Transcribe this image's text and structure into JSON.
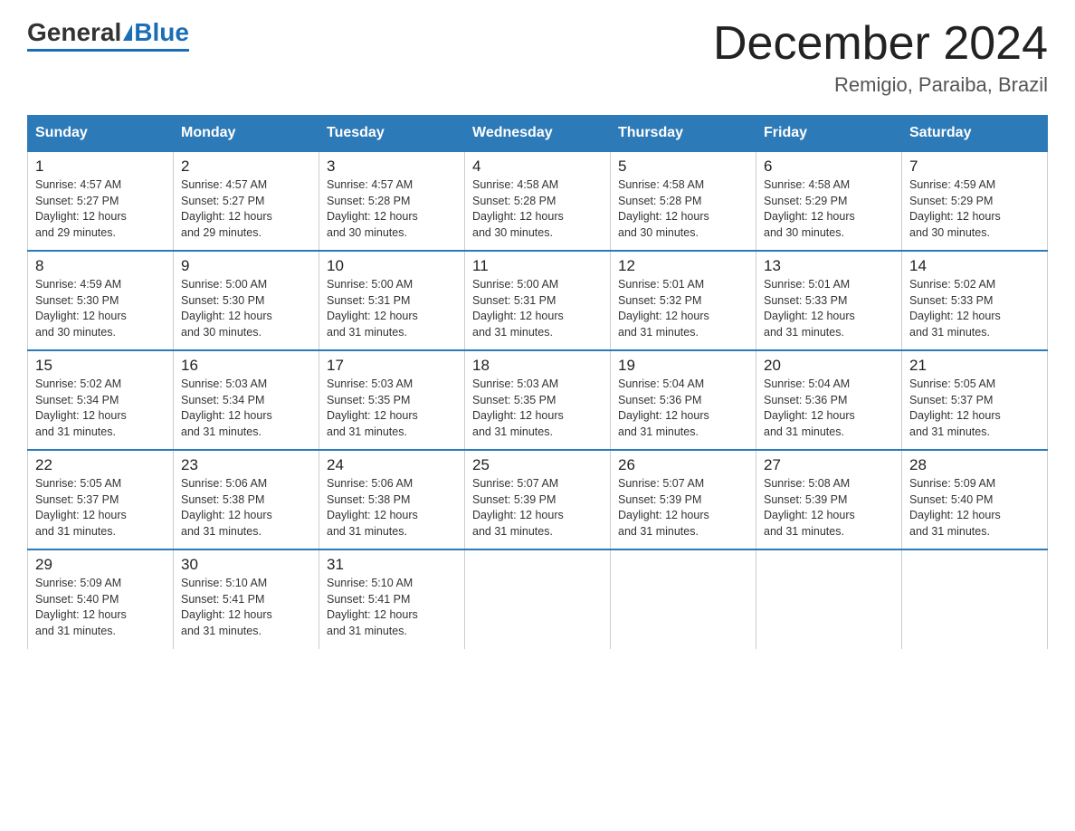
{
  "logo": {
    "general": "General",
    "blue": "Blue"
  },
  "title": "December 2024",
  "subtitle": "Remigio, Paraiba, Brazil",
  "headers": [
    "Sunday",
    "Monday",
    "Tuesday",
    "Wednesday",
    "Thursday",
    "Friday",
    "Saturday"
  ],
  "weeks": [
    [
      {
        "day": "1",
        "sunrise": "4:57 AM",
        "sunset": "5:27 PM",
        "daylight": "12 hours and 29 minutes."
      },
      {
        "day": "2",
        "sunrise": "4:57 AM",
        "sunset": "5:27 PM",
        "daylight": "12 hours and 29 minutes."
      },
      {
        "day": "3",
        "sunrise": "4:57 AM",
        "sunset": "5:28 PM",
        "daylight": "12 hours and 30 minutes."
      },
      {
        "day": "4",
        "sunrise": "4:58 AM",
        "sunset": "5:28 PM",
        "daylight": "12 hours and 30 minutes."
      },
      {
        "day": "5",
        "sunrise": "4:58 AM",
        "sunset": "5:28 PM",
        "daylight": "12 hours and 30 minutes."
      },
      {
        "day": "6",
        "sunrise": "4:58 AM",
        "sunset": "5:29 PM",
        "daylight": "12 hours and 30 minutes."
      },
      {
        "day": "7",
        "sunrise": "4:59 AM",
        "sunset": "5:29 PM",
        "daylight": "12 hours and 30 minutes."
      }
    ],
    [
      {
        "day": "8",
        "sunrise": "4:59 AM",
        "sunset": "5:30 PM",
        "daylight": "12 hours and 30 minutes."
      },
      {
        "day": "9",
        "sunrise": "5:00 AM",
        "sunset": "5:30 PM",
        "daylight": "12 hours and 30 minutes."
      },
      {
        "day": "10",
        "sunrise": "5:00 AM",
        "sunset": "5:31 PM",
        "daylight": "12 hours and 31 minutes."
      },
      {
        "day": "11",
        "sunrise": "5:00 AM",
        "sunset": "5:31 PM",
        "daylight": "12 hours and 31 minutes."
      },
      {
        "day": "12",
        "sunrise": "5:01 AM",
        "sunset": "5:32 PM",
        "daylight": "12 hours and 31 minutes."
      },
      {
        "day": "13",
        "sunrise": "5:01 AM",
        "sunset": "5:33 PM",
        "daylight": "12 hours and 31 minutes."
      },
      {
        "day": "14",
        "sunrise": "5:02 AM",
        "sunset": "5:33 PM",
        "daylight": "12 hours and 31 minutes."
      }
    ],
    [
      {
        "day": "15",
        "sunrise": "5:02 AM",
        "sunset": "5:34 PM",
        "daylight": "12 hours and 31 minutes."
      },
      {
        "day": "16",
        "sunrise": "5:03 AM",
        "sunset": "5:34 PM",
        "daylight": "12 hours and 31 minutes."
      },
      {
        "day": "17",
        "sunrise": "5:03 AM",
        "sunset": "5:35 PM",
        "daylight": "12 hours and 31 minutes."
      },
      {
        "day": "18",
        "sunrise": "5:03 AM",
        "sunset": "5:35 PM",
        "daylight": "12 hours and 31 minutes."
      },
      {
        "day": "19",
        "sunrise": "5:04 AM",
        "sunset": "5:36 PM",
        "daylight": "12 hours and 31 minutes."
      },
      {
        "day": "20",
        "sunrise": "5:04 AM",
        "sunset": "5:36 PM",
        "daylight": "12 hours and 31 minutes."
      },
      {
        "day": "21",
        "sunrise": "5:05 AM",
        "sunset": "5:37 PM",
        "daylight": "12 hours and 31 minutes."
      }
    ],
    [
      {
        "day": "22",
        "sunrise": "5:05 AM",
        "sunset": "5:37 PM",
        "daylight": "12 hours and 31 minutes."
      },
      {
        "day": "23",
        "sunrise": "5:06 AM",
        "sunset": "5:38 PM",
        "daylight": "12 hours and 31 minutes."
      },
      {
        "day": "24",
        "sunrise": "5:06 AM",
        "sunset": "5:38 PM",
        "daylight": "12 hours and 31 minutes."
      },
      {
        "day": "25",
        "sunrise": "5:07 AM",
        "sunset": "5:39 PM",
        "daylight": "12 hours and 31 minutes."
      },
      {
        "day": "26",
        "sunrise": "5:07 AM",
        "sunset": "5:39 PM",
        "daylight": "12 hours and 31 minutes."
      },
      {
        "day": "27",
        "sunrise": "5:08 AM",
        "sunset": "5:39 PM",
        "daylight": "12 hours and 31 minutes."
      },
      {
        "day": "28",
        "sunrise": "5:09 AM",
        "sunset": "5:40 PM",
        "daylight": "12 hours and 31 minutes."
      }
    ],
    [
      {
        "day": "29",
        "sunrise": "5:09 AM",
        "sunset": "5:40 PM",
        "daylight": "12 hours and 31 minutes."
      },
      {
        "day": "30",
        "sunrise": "5:10 AM",
        "sunset": "5:41 PM",
        "daylight": "12 hours and 31 minutes."
      },
      {
        "day": "31",
        "sunrise": "5:10 AM",
        "sunset": "5:41 PM",
        "daylight": "12 hours and 31 minutes."
      },
      null,
      null,
      null,
      null
    ]
  ],
  "labels": {
    "sunrise": "Sunrise:",
    "sunset": "Sunset:",
    "daylight": "Daylight:"
  }
}
